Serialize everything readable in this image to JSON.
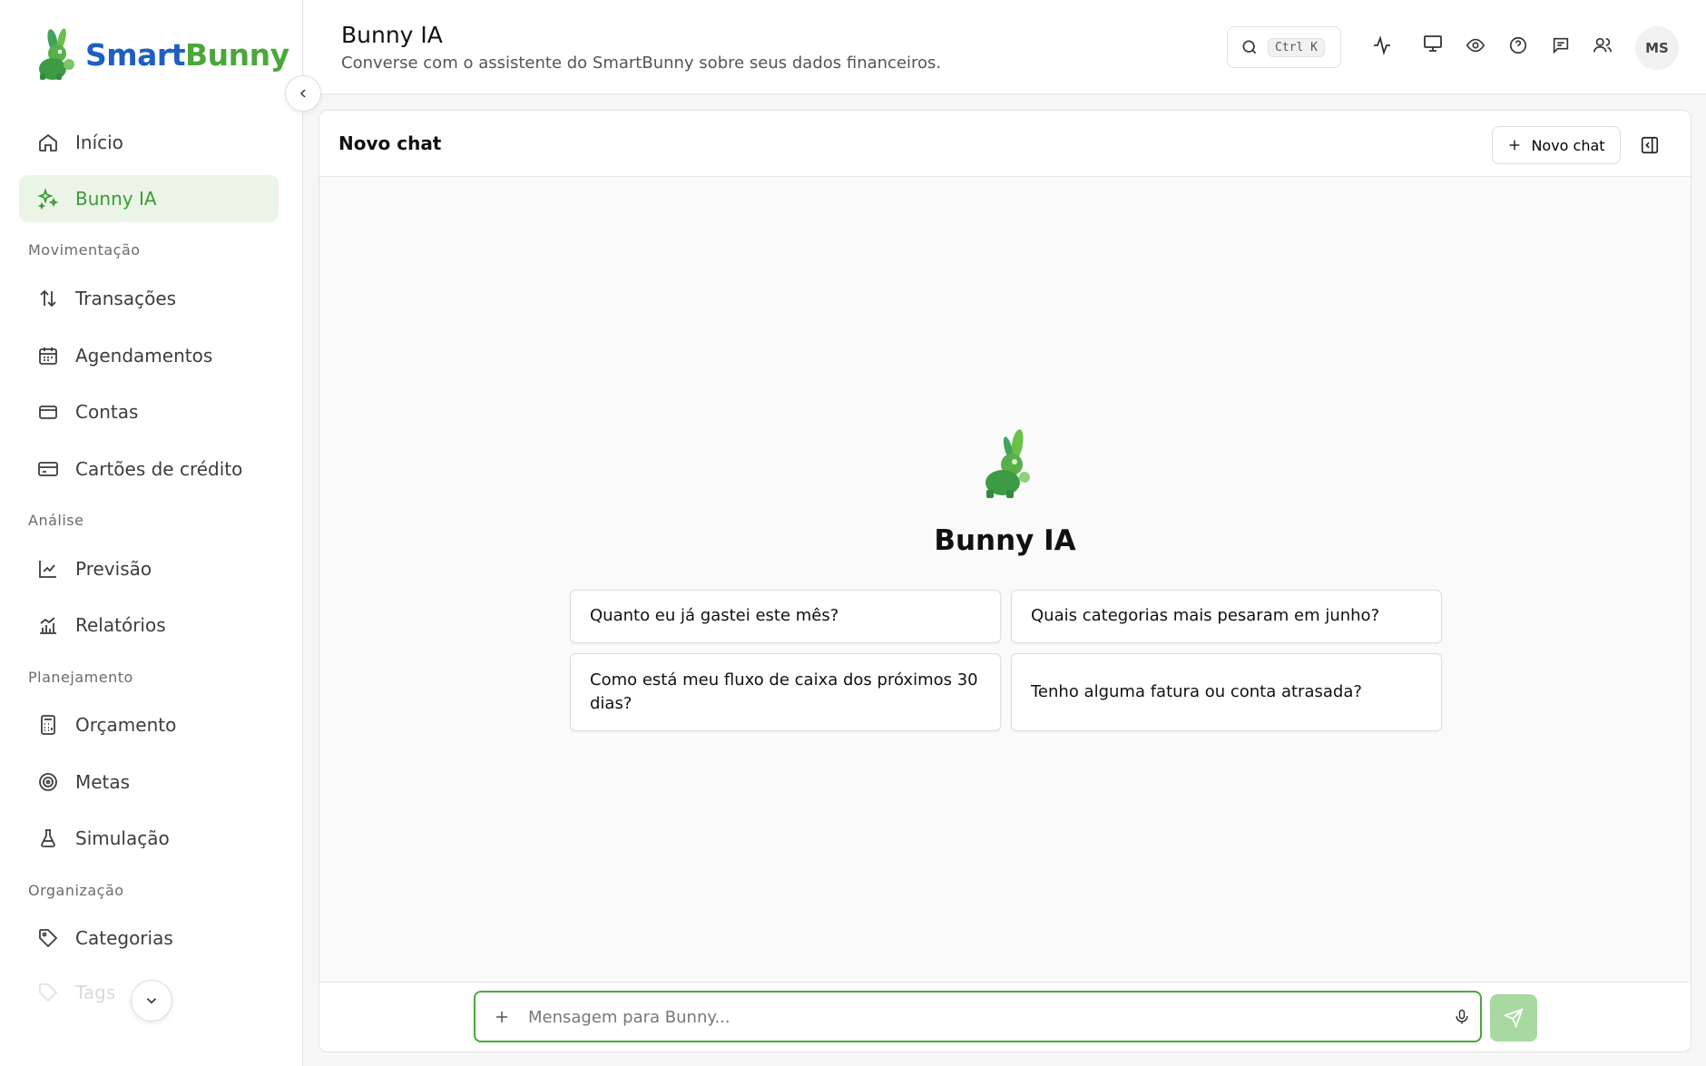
{
  "brand": {
    "part1": "Smart",
    "part2": "Bunny",
    "color_primary": "#1e5fc1",
    "color_accent": "#4aa83a"
  },
  "sidebar": {
    "items": [
      {
        "label": "Início",
        "icon": "home-icon",
        "active": false
      },
      {
        "label": "Bunny IA",
        "icon": "sparkles-icon",
        "active": true
      }
    ],
    "sections": [
      {
        "label": "Movimentação",
        "items": [
          {
            "label": "Transações",
            "icon": "arrows-up-down-icon"
          },
          {
            "label": "Agendamentos",
            "icon": "calendar-icon"
          },
          {
            "label": "Contas",
            "icon": "wallet-icon"
          },
          {
            "label": "Cartões de crédito",
            "icon": "credit-card-icon"
          }
        ]
      },
      {
        "label": "Análise",
        "items": [
          {
            "label": "Previsão",
            "icon": "line-chart-icon"
          },
          {
            "label": "Relatórios",
            "icon": "bar-chart-icon"
          }
        ]
      },
      {
        "label": "Planejamento",
        "items": [
          {
            "label": "Orçamento",
            "icon": "calculator-icon"
          },
          {
            "label": "Metas",
            "icon": "target-icon"
          },
          {
            "label": "Simulação",
            "icon": "flask-icon"
          }
        ]
      },
      {
        "label": "Organização",
        "items": [
          {
            "label": "Categorias",
            "icon": "tag-icon"
          },
          {
            "label": "Tags",
            "icon": "tags-icon"
          }
        ]
      }
    ]
  },
  "header": {
    "title": "Bunny IA",
    "subtitle": "Converse com o assistente do SmartBunny sobre seus dados financeiros.",
    "search_shortcut": "Ctrl K",
    "avatar_initials": "MS"
  },
  "chat": {
    "panel_title": "Novo chat",
    "new_chat_label": "Novo chat",
    "hero_title": "Bunny IA",
    "suggestions": [
      "Quanto eu já gastei este mês?",
      "Quais categorias mais pesaram em junho?",
      "Como está meu fluxo de caixa dos próximos 30 dias?",
      "Tenho alguma fatura ou conta atrasada?"
    ],
    "input_placeholder": "Mensagem para Bunny..."
  }
}
